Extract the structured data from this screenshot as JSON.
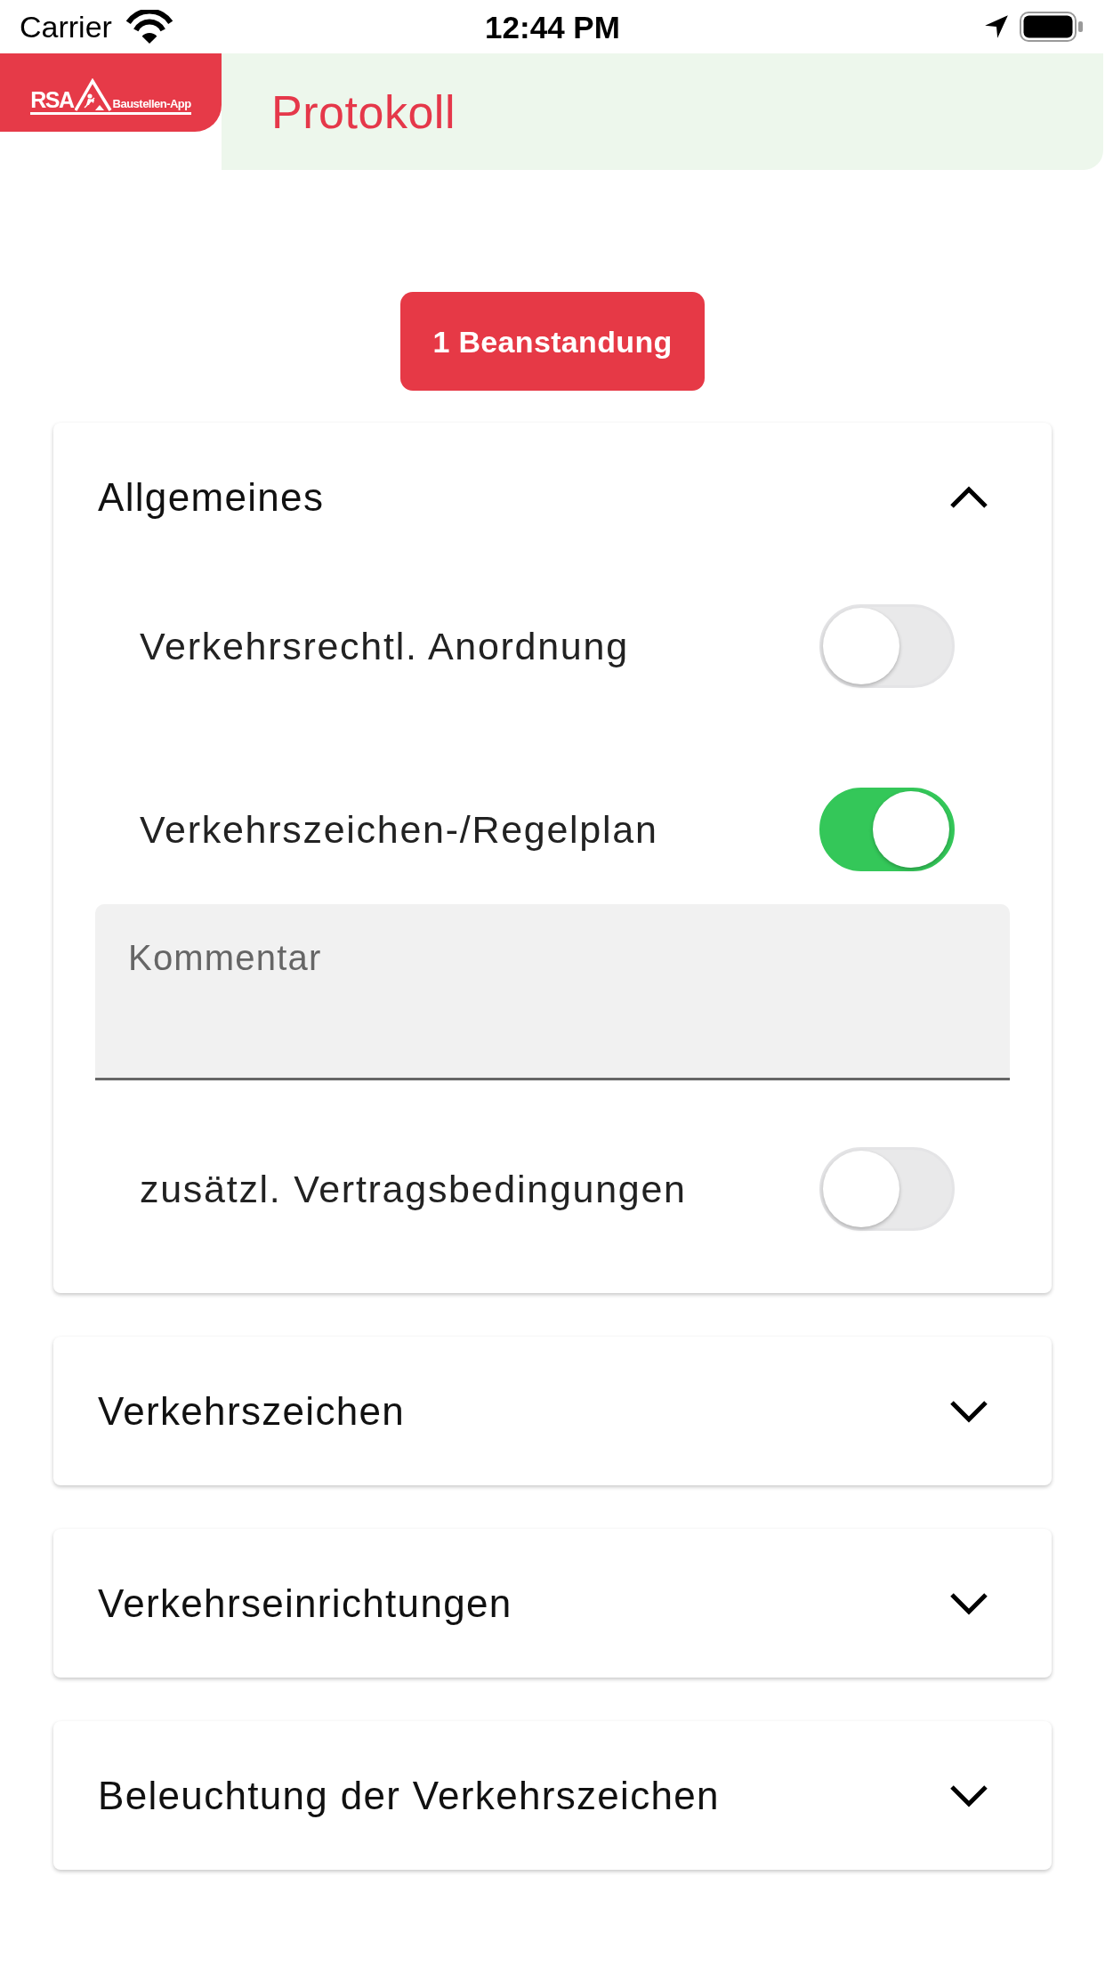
{
  "status_bar": {
    "carrier": "Carrier",
    "time": "12:44 PM"
  },
  "header": {
    "logo": {
      "brand": "RSA",
      "subtitle": "Baustellen-App"
    },
    "title": "Protokoll"
  },
  "issues_button": {
    "label": "1 Beanstandung"
  },
  "sections": [
    {
      "title": "Allgemeines",
      "expanded": true,
      "items": [
        {
          "label": "Verkehrsrechtl. Anordnung",
          "on": false
        },
        {
          "label": "Verkehrszeichen-/Regelplan",
          "on": true,
          "comment": {
            "placeholder": "Kommentar"
          }
        },
        {
          "label": "zusätzl. Vertragsbedingungen",
          "on": false
        }
      ]
    },
    {
      "title": "Verkehrszeichen",
      "expanded": false
    },
    {
      "title": "Verkehrseinrichtungen",
      "expanded": false
    },
    {
      "title": "Beleuchtung der Verkehrszeichen",
      "expanded": false
    }
  ]
}
